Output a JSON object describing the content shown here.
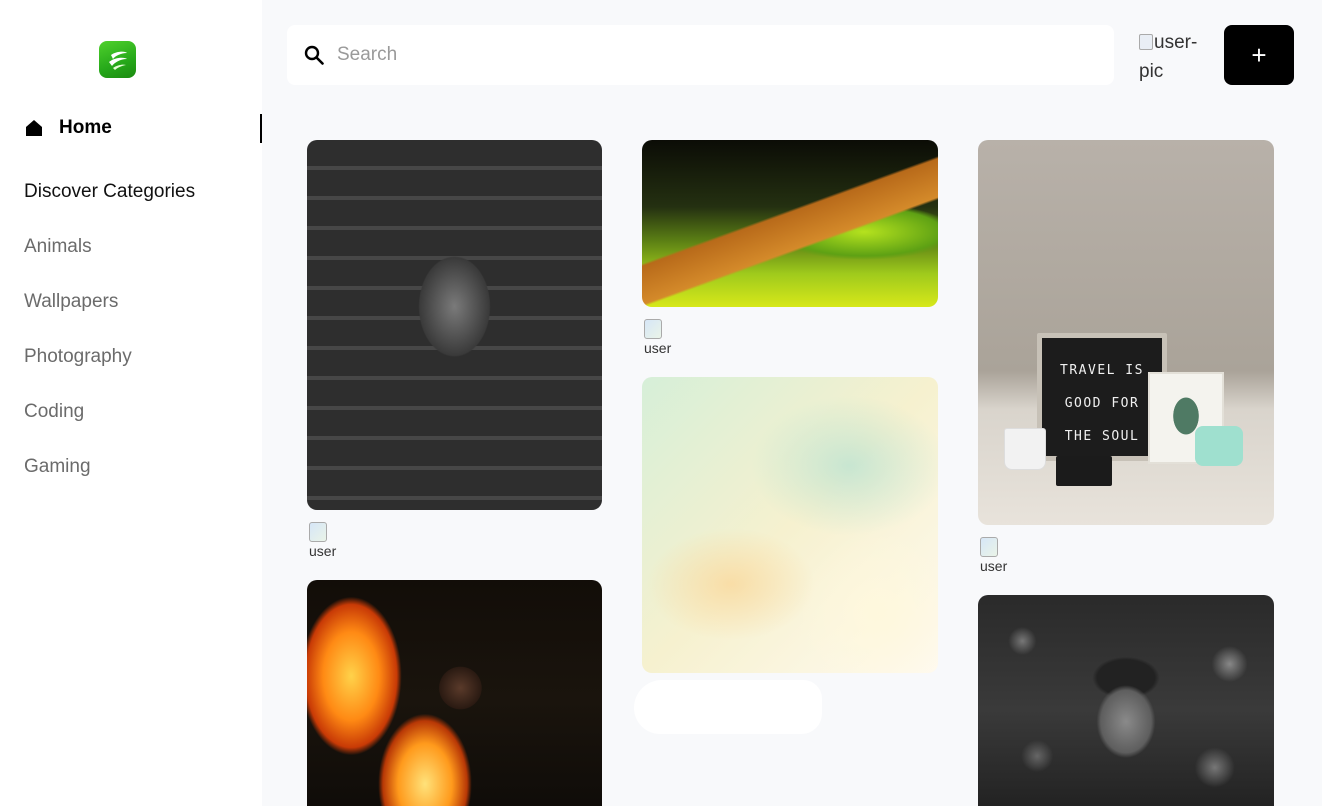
{
  "sidebar": {
    "logo_icon": "app-logo-icon",
    "home_label": "Home",
    "categories_heading": "Discover Categories",
    "categories": [
      "Animals",
      "Wallpapers",
      "Photography",
      "Coding",
      "Gaming"
    ]
  },
  "header": {
    "search_placeholder": "Search",
    "search_value": "",
    "user_pic_alt": "user-pic",
    "add_button_label": "+"
  },
  "pins": [
    {
      "name": "guitar-player-photo",
      "user_alt": "user"
    },
    {
      "name": "park-path-photo",
      "user_alt": "user"
    },
    {
      "name": "watercolor-photo",
      "user_alt": ""
    },
    {
      "name": "travel-board-photo",
      "user_alt": "user",
      "board_text": [
        "TRAVEL IS",
        "GOOD FOR",
        "THE SOUL"
      ]
    },
    {
      "name": "fire-performer-photo",
      "user_alt": ""
    },
    {
      "name": "boy-portrait-photo",
      "user_alt": ""
    }
  ],
  "colors": {
    "accent": "#000000",
    "background": "#f8f9fb",
    "logo_green": "#26a81a",
    "muted_text": "#6b6b6b"
  }
}
